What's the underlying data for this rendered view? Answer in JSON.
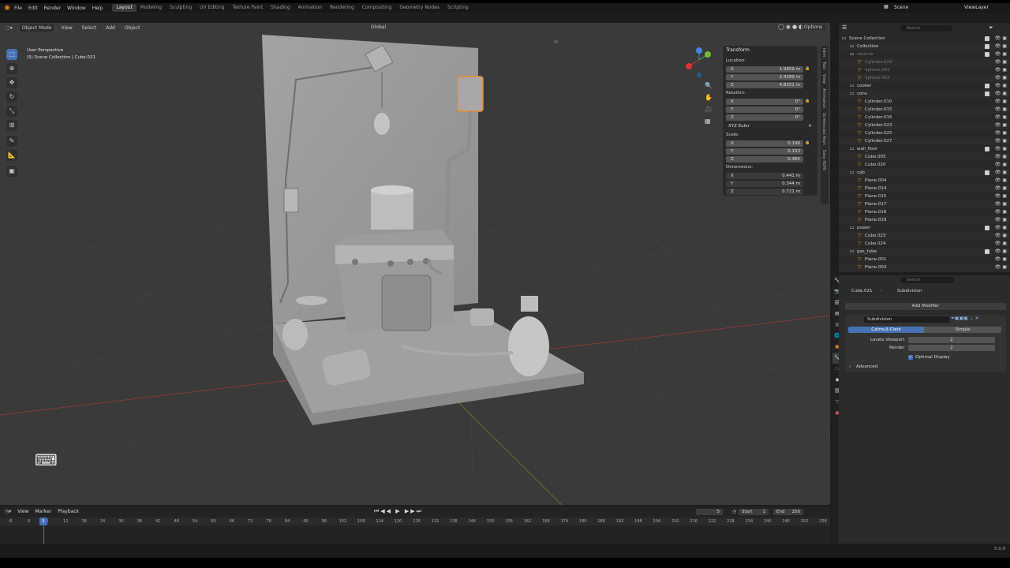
{
  "menu": {
    "items": [
      "File",
      "Edit",
      "Render",
      "Window",
      "Help"
    ],
    "workspaces": [
      "Layout",
      "Modeling",
      "Sculpting",
      "UV Editing",
      "Texture Paint",
      "Shading",
      "Animation",
      "Rendering",
      "Compositing",
      "Geometry Nodes",
      "Scripting"
    ],
    "scene": "Scene",
    "view_layer": "ViewLayer"
  },
  "viewport": {
    "mode": "Object Mode",
    "menus": [
      "View",
      "Select",
      "Add",
      "Object"
    ],
    "orientation": "Global",
    "options": "Options",
    "persp_label": "User Perspective",
    "collection_label": "(5) Scene Collection | Cube.021"
  },
  "npanel": {
    "header": "Transform",
    "location_label": "Location:",
    "location": [
      {
        "axis": "X",
        "value": "1.9959 m"
      },
      {
        "axis": "Y",
        "value": "2.4299 m"
      },
      {
        "axis": "Z",
        "value": "4.8251 m"
      }
    ],
    "rotation_label": "Rotation:",
    "rotation": [
      {
        "axis": "X",
        "value": "0°"
      },
      {
        "axis": "Y",
        "value": "0°"
      },
      {
        "axis": "Z",
        "value": "0°"
      }
    ],
    "rotation_mode": "XYZ Euler",
    "scale_label": "Scale:",
    "scale": [
      {
        "axis": "X",
        "value": "0.196"
      },
      {
        "axis": "Y",
        "value": "0.153"
      },
      {
        "axis": "Z",
        "value": "0.484"
      }
    ],
    "dimensions_label": "Dimensions:",
    "dimensions": [
      {
        "axis": "X",
        "value": "0.441 m"
      },
      {
        "axis": "Y",
        "value": "0.344 m"
      },
      {
        "axis": "Z",
        "value": "0.721 m"
      }
    ],
    "tabs": [
      "Item",
      "Tool",
      "View",
      "Animation",
      "Screencast Keys",
      "Easy HDRI"
    ]
  },
  "outliner": {
    "search": "Search",
    "rows": [
      {
        "name": "Scene Collection",
        "level": 0,
        "icon": "collection"
      },
      {
        "name": "Collection",
        "level": 1,
        "icon": "collection"
      },
      {
        "name": "reserve",
        "level": 1,
        "icon": "collection",
        "dim": true
      },
      {
        "name": "Cylinder.024",
        "level": 2,
        "icon": "mesh",
        "dim": true
      },
      {
        "name": "Sphere.001",
        "level": 2,
        "icon": "mesh",
        "dim": true
      },
      {
        "name": "Sphere.002",
        "level": 2,
        "icon": "mesh",
        "dim": true
      },
      {
        "name": "cooker",
        "level": 1,
        "icon": "collection"
      },
      {
        "name": "cons",
        "level": 1,
        "icon": "collection"
      },
      {
        "name": "Cylinder.010",
        "level": 2,
        "icon": "mesh"
      },
      {
        "name": "Cylinder.015",
        "level": 2,
        "icon": "mesh"
      },
      {
        "name": "Cylinder.016",
        "level": 2,
        "icon": "mesh"
      },
      {
        "name": "Cylinder.023",
        "level": 2,
        "icon": "mesh"
      },
      {
        "name": "Cylinder.025",
        "level": 2,
        "icon": "mesh"
      },
      {
        "name": "Cylinder.027",
        "level": 2,
        "icon": "mesh"
      },
      {
        "name": "wall_floor",
        "level": 1,
        "icon": "collection"
      },
      {
        "name": "Cube.005",
        "level": 2,
        "icon": "mesh"
      },
      {
        "name": "Cube.020",
        "level": 2,
        "icon": "mesh"
      },
      {
        "name": "cab",
        "level": 1,
        "icon": "collection"
      },
      {
        "name": "Plane.004",
        "level": 2,
        "icon": "mesh"
      },
      {
        "name": "Plane.014",
        "level": 2,
        "icon": "mesh"
      },
      {
        "name": "Plane.015",
        "level": 2,
        "icon": "mesh"
      },
      {
        "name": "Plane.017",
        "level": 2,
        "icon": "mesh"
      },
      {
        "name": "Plane.018",
        "level": 2,
        "icon": "mesh"
      },
      {
        "name": "Plane.019",
        "level": 2,
        "icon": "mesh"
      },
      {
        "name": "power",
        "level": 1,
        "icon": "collection"
      },
      {
        "name": "Cube.023",
        "level": 2,
        "icon": "mesh"
      },
      {
        "name": "Cube.024",
        "level": 2,
        "icon": "mesh"
      },
      {
        "name": "gas_tube",
        "level": 1,
        "icon": "collection"
      },
      {
        "name": "Plane.001",
        "level": 2,
        "icon": "mesh"
      },
      {
        "name": "Plane.003",
        "level": 2,
        "icon": "mesh"
      }
    ]
  },
  "properties": {
    "search": "Search",
    "object": "Cube.021",
    "modifier_crumb": "Subdivision",
    "add_modifier": "Add Modifier",
    "modifier_name": "Subdivision",
    "catmull": "Catmull-Clark",
    "simple": "Simple",
    "levels_viewport_label": "Levels Viewport",
    "levels_viewport": "2",
    "render_label": "Render",
    "render": "2",
    "optimal_display": "Optimal Display",
    "advanced": "Advanced"
  },
  "timeline": {
    "menus": [
      "View",
      "Marker",
      "Playback"
    ],
    "current_frame": "5",
    "start_label": "Start",
    "start": "1",
    "end_label": "End",
    "end": "250",
    "ticks": [
      "-6",
      "0",
      "6",
      "12",
      "18",
      "24",
      "30",
      "36",
      "42",
      "48",
      "54",
      "60",
      "66",
      "72",
      "78",
      "84",
      "90",
      "96",
      "102",
      "108",
      "114",
      "120",
      "126",
      "132",
      "138",
      "144",
      "150",
      "156",
      "162",
      "168",
      "174",
      "180",
      "186",
      "192",
      "198",
      "204",
      "210",
      "216",
      "222",
      "228",
      "234",
      "240",
      "246",
      "252",
      "258"
    ],
    "playhead": "5"
  },
  "status": {
    "version": "5.0.0"
  }
}
